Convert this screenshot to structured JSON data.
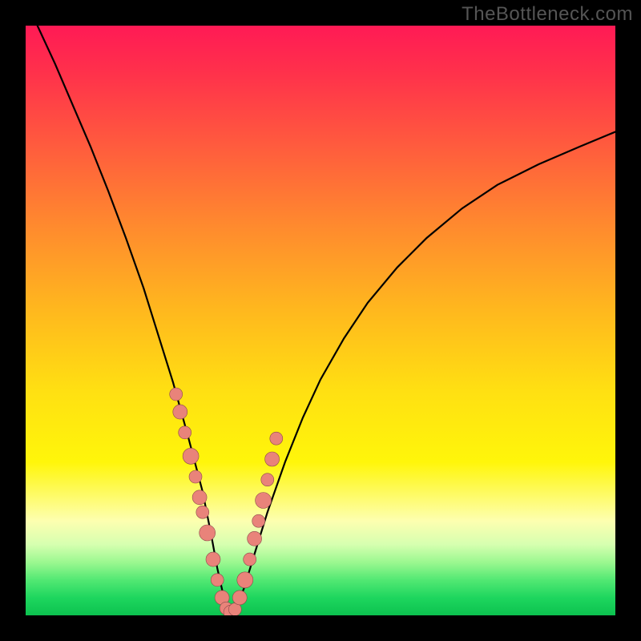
{
  "watermark": "TheBottleneck.com",
  "chart_data": {
    "type": "line",
    "title": "",
    "xlabel": "",
    "ylabel": "",
    "xlim": [
      0,
      1
    ],
    "ylim": [
      0,
      1
    ],
    "series": [
      {
        "name": "curve",
        "x": [
          0.02,
          0.05,
          0.08,
          0.11,
          0.14,
          0.17,
          0.2,
          0.225,
          0.25,
          0.275,
          0.3,
          0.315,
          0.325,
          0.335,
          0.345,
          0.355,
          0.37,
          0.39,
          0.41,
          0.44,
          0.47,
          0.5,
          0.54,
          0.58,
          0.63,
          0.68,
          0.74,
          0.8,
          0.87,
          0.94,
          1.0
        ],
        "y": [
          1.0,
          0.935,
          0.865,
          0.795,
          0.72,
          0.64,
          0.555,
          0.475,
          0.395,
          0.305,
          0.21,
          0.135,
          0.08,
          0.035,
          0.008,
          0.01,
          0.045,
          0.11,
          0.175,
          0.26,
          0.335,
          0.4,
          0.47,
          0.53,
          0.59,
          0.64,
          0.69,
          0.73,
          0.765,
          0.795,
          0.82
        ]
      },
      {
        "name": "dots",
        "x": [
          0.255,
          0.262,
          0.27,
          0.28,
          0.288,
          0.295,
          0.3,
          0.308,
          0.318,
          0.325,
          0.333,
          0.34,
          0.348,
          0.355,
          0.363,
          0.372,
          0.38,
          0.388,
          0.395,
          0.403,
          0.41,
          0.418,
          0.425
        ],
        "y": [
          0.375,
          0.345,
          0.31,
          0.27,
          0.235,
          0.2,
          0.175,
          0.14,
          0.095,
          0.06,
          0.03,
          0.012,
          0.005,
          0.01,
          0.03,
          0.06,
          0.095,
          0.13,
          0.16,
          0.195,
          0.23,
          0.265,
          0.3
        ],
        "r": [
          8,
          9,
          8,
          10,
          8,
          9,
          8,
          10,
          9,
          8,
          9,
          8,
          9,
          8,
          9,
          10,
          8,
          9,
          8,
          10,
          8,
          9,
          8
        ]
      }
    ],
    "gradient_note": "background vertical gradient from red (top) through orange/yellow to green (bottom)"
  }
}
